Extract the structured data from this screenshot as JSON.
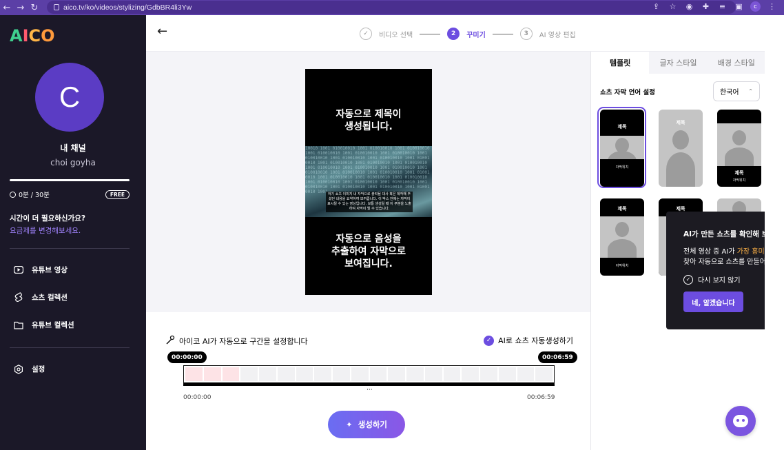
{
  "browser": {
    "url": "aico.tv/ko/videos/stylizing/GdbBR4li3Yw",
    "profile_initial": "c"
  },
  "sidebar": {
    "logo": [
      "A",
      "I",
      "C",
      "O"
    ],
    "logo_colors": [
      "#3fcf8e",
      "#ff5a6e",
      "#ffb547",
      "#ff9a3c"
    ],
    "avatar_initial": "C",
    "channel_title": "내 채널",
    "channel_user": "choi goyha",
    "usage_text": "0분 / 30분",
    "usage_fraction": 1.0,
    "plan_badge": "FREE",
    "more_time": "시간이 더 필요하신가요?",
    "change_plan": "요금제를 변경해보세요.",
    "menu": [
      {
        "label": "유튜브 영상",
        "icon": "youtube-icon"
      },
      {
        "label": "쇼츠 컬렉션",
        "icon": "shorts-icon"
      },
      {
        "label": "유튜브 컬렉션",
        "icon": "folder-icon"
      }
    ],
    "settings_label": "설정",
    "settings_icon": "settings-icon"
  },
  "header": {
    "steps": [
      {
        "num": "✓",
        "label": "비디오 선택",
        "state": "done"
      },
      {
        "num": "2",
        "label": "꾸미기",
        "state": "active"
      },
      {
        "num": "3",
        "label": "AI 영상 편집",
        "state": "todo"
      }
    ],
    "accent": "#6c4de0"
  },
  "preview": {
    "title_line1": "자동으로 제목이",
    "title_line2": "생성됩니다.",
    "caption": "하기 쇼츠 이미지 내 자막으로 출력될 대사 혹은 제작해 주 셨던 내용을 요약하여 보여줍니다. 이 박스 안에는 자막이 표시될 수 있는 영상입니다. 보통 생성될 때 이 부분을 노출하여 자막이 될 수 있습니다.",
    "sub_line1": "자동으로 음성을",
    "sub_line2": "추출하여 자막으로",
    "sub_line3": "보여집니다."
  },
  "timeline": {
    "auto_label": "아이코 AI가 자동으로 구간을 설정합니다",
    "auto_gen_label": "AI로 쇼츠 자동생성하기",
    "start_pill": "00:00:00",
    "end_pill": "00:06:59",
    "start_time": "00:00:00",
    "end_time": "00:06:59",
    "segments": 20,
    "highlighted": [
      0,
      1,
      2
    ],
    "handle": "···",
    "generate_label": "생성하기"
  },
  "right_panel": {
    "tabs": [
      "템플릿",
      "글자 스타일",
      "배경 스타일"
    ],
    "active_tab": 0,
    "lang_label": "쇼츠 자막 언어 설정",
    "lang_value": "한국어",
    "template_title": "제목",
    "template_caption": "자막위치"
  },
  "tooltip": {
    "title": "AI가 만든 쇼츠를 확인해 보세요",
    "body_pre": "전체 영상 중 AI가 ",
    "body_highlight": "가장 흥미",
    "body_line2": "찾아 자동으로 쇼츠를 만들어",
    "no_show": "다시 보지 않기",
    "ok_button": "네, 알겠습니다"
  }
}
